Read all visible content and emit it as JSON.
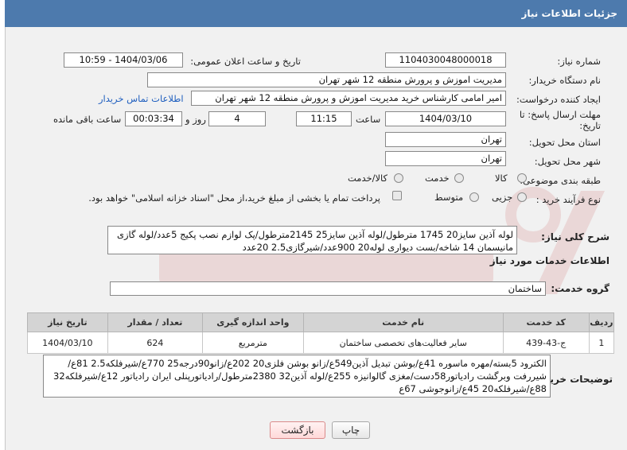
{
  "header": {
    "title": "جزئیات اطلاعات نیاز"
  },
  "form": {
    "need_number_label": "شماره نیاز:",
    "need_number": "1104030048000018",
    "announce_label": "تاریخ و ساعت اعلان عمومی:",
    "announce_value": "1404/03/06 - 10:59",
    "buyer_label": "نام دستگاه خریدار:",
    "buyer_value": "مدیریت اموزش و پرورش منطقه 12 شهر تهران",
    "creator_label": "ایجاد کننده درخواست:",
    "creator_value": "امیر امامی کارشناس خرید مدیریت اموزش و پرورش منطقه 12 شهر تهران",
    "contact_link": "اطلاعات تماس خریدار",
    "deadline_label_1": "مهلت ارسال پاسخ: تا",
    "deadline_label_2": "تاریخ:",
    "deadline_date": "1404/03/10",
    "time_label": "ساعت",
    "deadline_time": "11:15",
    "days_value": "4",
    "days_label": "روز و",
    "remaining_value": "00:03:34",
    "remaining_label": "ساعت باقی مانده",
    "province_label": "استان محل تحویل:",
    "province_value": "تهران",
    "city_label": "شهر محل تحویل:",
    "city_value": "تهران",
    "category_label": "طبقه بندی موضوعی:",
    "category_options": [
      "کالا",
      "خدمت",
      "کالا/خدمت"
    ],
    "process_label": "نوع فرآیند خرید :",
    "process_options": [
      "جزیی",
      "متوسط"
    ],
    "payment_text": "پرداخت تمام یا بخشی از مبلغ خرید،از محل \"اسناد خزانه اسلامی\" خواهد بود."
  },
  "summary": {
    "label": "شرح کلی نیاز:",
    "text": "لوله آذین سایز20 1745 مترطول/لوله آذین سایز25 2145مترطول/پک لوازم نصب پکیج 5عدد/لوله گازی مانیسمان 14 شاخه/بست دیواری لوله20 900عدد/شیرگازی2.5 20عدد"
  },
  "services": {
    "section_title": "اطلاعات خدمات مورد نیاز",
    "group_label": "گروه خدمت:",
    "group_value": "ساختمان",
    "columns": [
      "ردیف",
      "کد خدمت",
      "نام خدمت",
      "واحد اندازه گیری",
      "تعداد / مقدار",
      "تاریخ نیاز"
    ],
    "rows": [
      {
        "index": "1",
        "code": "ج-43-439",
        "name": "سایر فعالیت‌های تخصصی ساختمان",
        "unit": "مترمربع",
        "qty": "624",
        "date": "1404/03/10"
      }
    ]
  },
  "description": {
    "label": "توضیحات خریدار:",
    "text": "الکترود 5بسته/مهره ماسوره 41ع/بوشن تبدیل آذین549ع/زانو بوشن فلزی20 202ع/زانو90درجه25 770ع/شیرفلکه2.5 81ع/شیررفت وبرگشت رادیاتور58دست/مغزی گالوانیزه 255ع/لوله آذین32 2380مترطول/رادیاتورپنلی ایران رادیاتور 12ع/شیرفلکه32 88ع/شیرفلکه20 45ع/زانوجوشی 67ع"
  },
  "buttons": {
    "print": "چاپ",
    "back": "بازگشت"
  },
  "colors": {
    "header": "#4d7aad",
    "link": "#1f5fbf"
  }
}
